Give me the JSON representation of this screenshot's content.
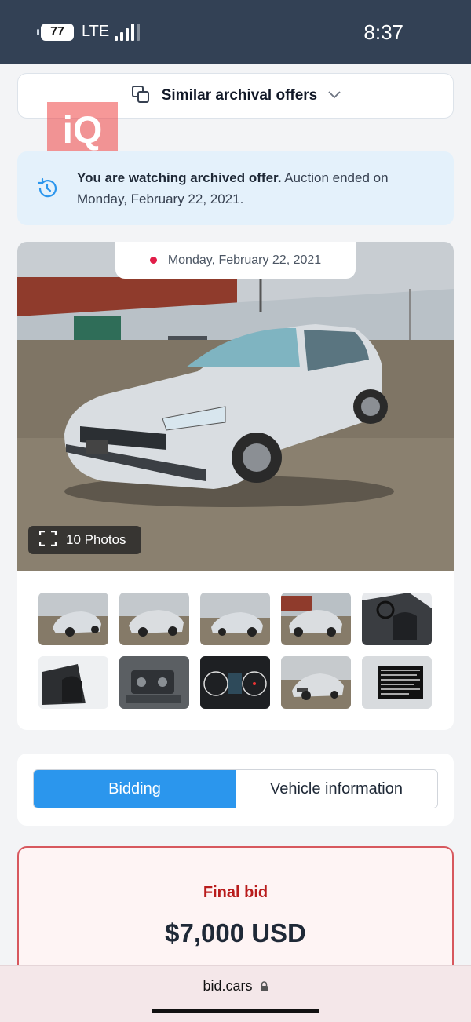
{
  "status_bar": {
    "battery": "77",
    "network": "LTE",
    "time": "8:37"
  },
  "similar_offers": {
    "label": "Similar archival offers"
  },
  "watermark": {
    "text": "iQ"
  },
  "archive_notice": {
    "bold_text": "You are watching archived offer.",
    "rest_text": " Auction ended on Monday, February 22, 2021."
  },
  "gallery": {
    "date": "Monday, February 22, 2021",
    "photos_label": "10 Photos",
    "thumbnail_count": 10
  },
  "tabs": [
    {
      "label": "Bidding",
      "active": true
    },
    {
      "label": "Vehicle information",
      "active": false
    }
  ],
  "final_bid": {
    "label": "Final bid",
    "value": "$7,000 USD"
  },
  "browser": {
    "url": "bid.cars"
  },
  "colors": {
    "status_bar": "#334155",
    "accent_blue": "#2b96ed",
    "notice_bg": "#e4f1fb",
    "final_bid_red": "#b91c1c",
    "final_bid_border": "#d7585e"
  }
}
